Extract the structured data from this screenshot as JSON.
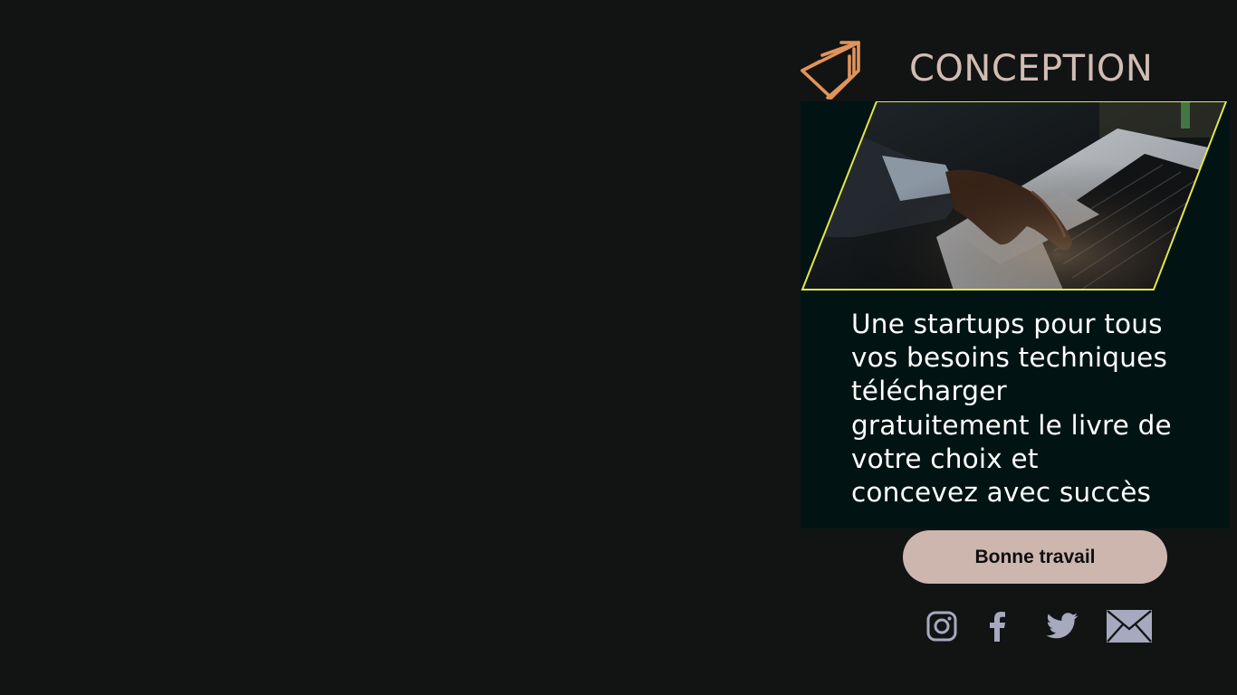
{
  "brand": {
    "title": "CONCEPTION",
    "accent_color": "#d2bcb3",
    "logo_icon": "layered-triangles-logo",
    "logo_color": "#e0945b"
  },
  "hero": {
    "image": "person-typing-on-laptop",
    "frame_color": "#e2e64a"
  },
  "tagline": {
    "lines": [
      "Une startups pour tous",
      "vos besoins techniques",
      "télécharger",
      "gratuitement le livre de",
      "votre choix et",
      "concevez avec succès"
    ]
  },
  "cta": {
    "label": "Bonne travail",
    "color": "#ccb6ae"
  },
  "social": {
    "icons": [
      "instagram-icon",
      "facebook-icon",
      "twitter-icon",
      "email-icon"
    ],
    "color": "#a7a9bf"
  }
}
